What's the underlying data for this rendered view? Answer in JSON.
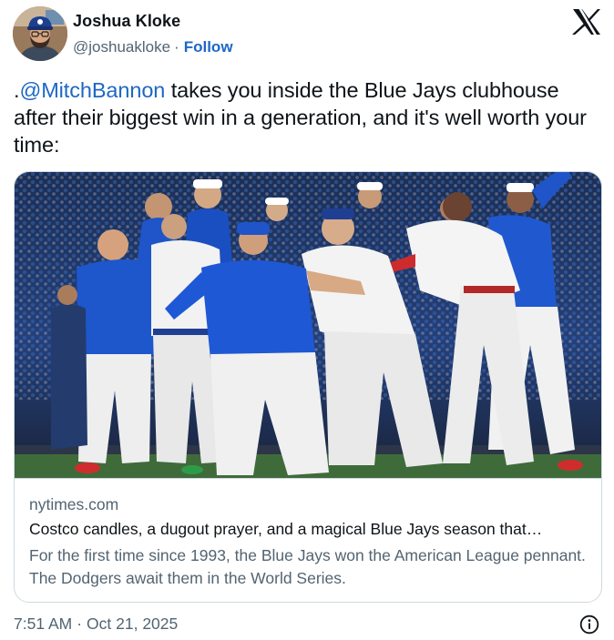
{
  "author": {
    "name": "Joshua Kloke",
    "handle": "@joshuakloke",
    "separator": "·",
    "follow_label": "Follow"
  },
  "platform_icon": "x-logo-icon",
  "tweet": {
    "text_prefix": ".",
    "mention": "@MitchBannon",
    "text_rest": " takes you inside the Blue Jays clubhouse after their biggest win in a generation, and it's well worth your time:"
  },
  "card": {
    "image_description_icon": "celebration-photo",
    "domain": "nytimes.com",
    "title": "Costco candles, a dugout prayer, and a magical Blue Jays season that…",
    "description": "For the first time since 1993, the Blue Jays won the American League pennant. The Dodgers await them in the World Series."
  },
  "footer": {
    "time": "7:51 AM",
    "separator": "·",
    "date": "Oct 21, 2025",
    "info_icon": "info-icon"
  },
  "colors": {
    "link_blue": "#1d68c4",
    "secondary_text": "#536471",
    "border": "#cfd9de",
    "jays_blue": "#1e5bd6",
    "uniform_white": "#f2f2f2"
  }
}
